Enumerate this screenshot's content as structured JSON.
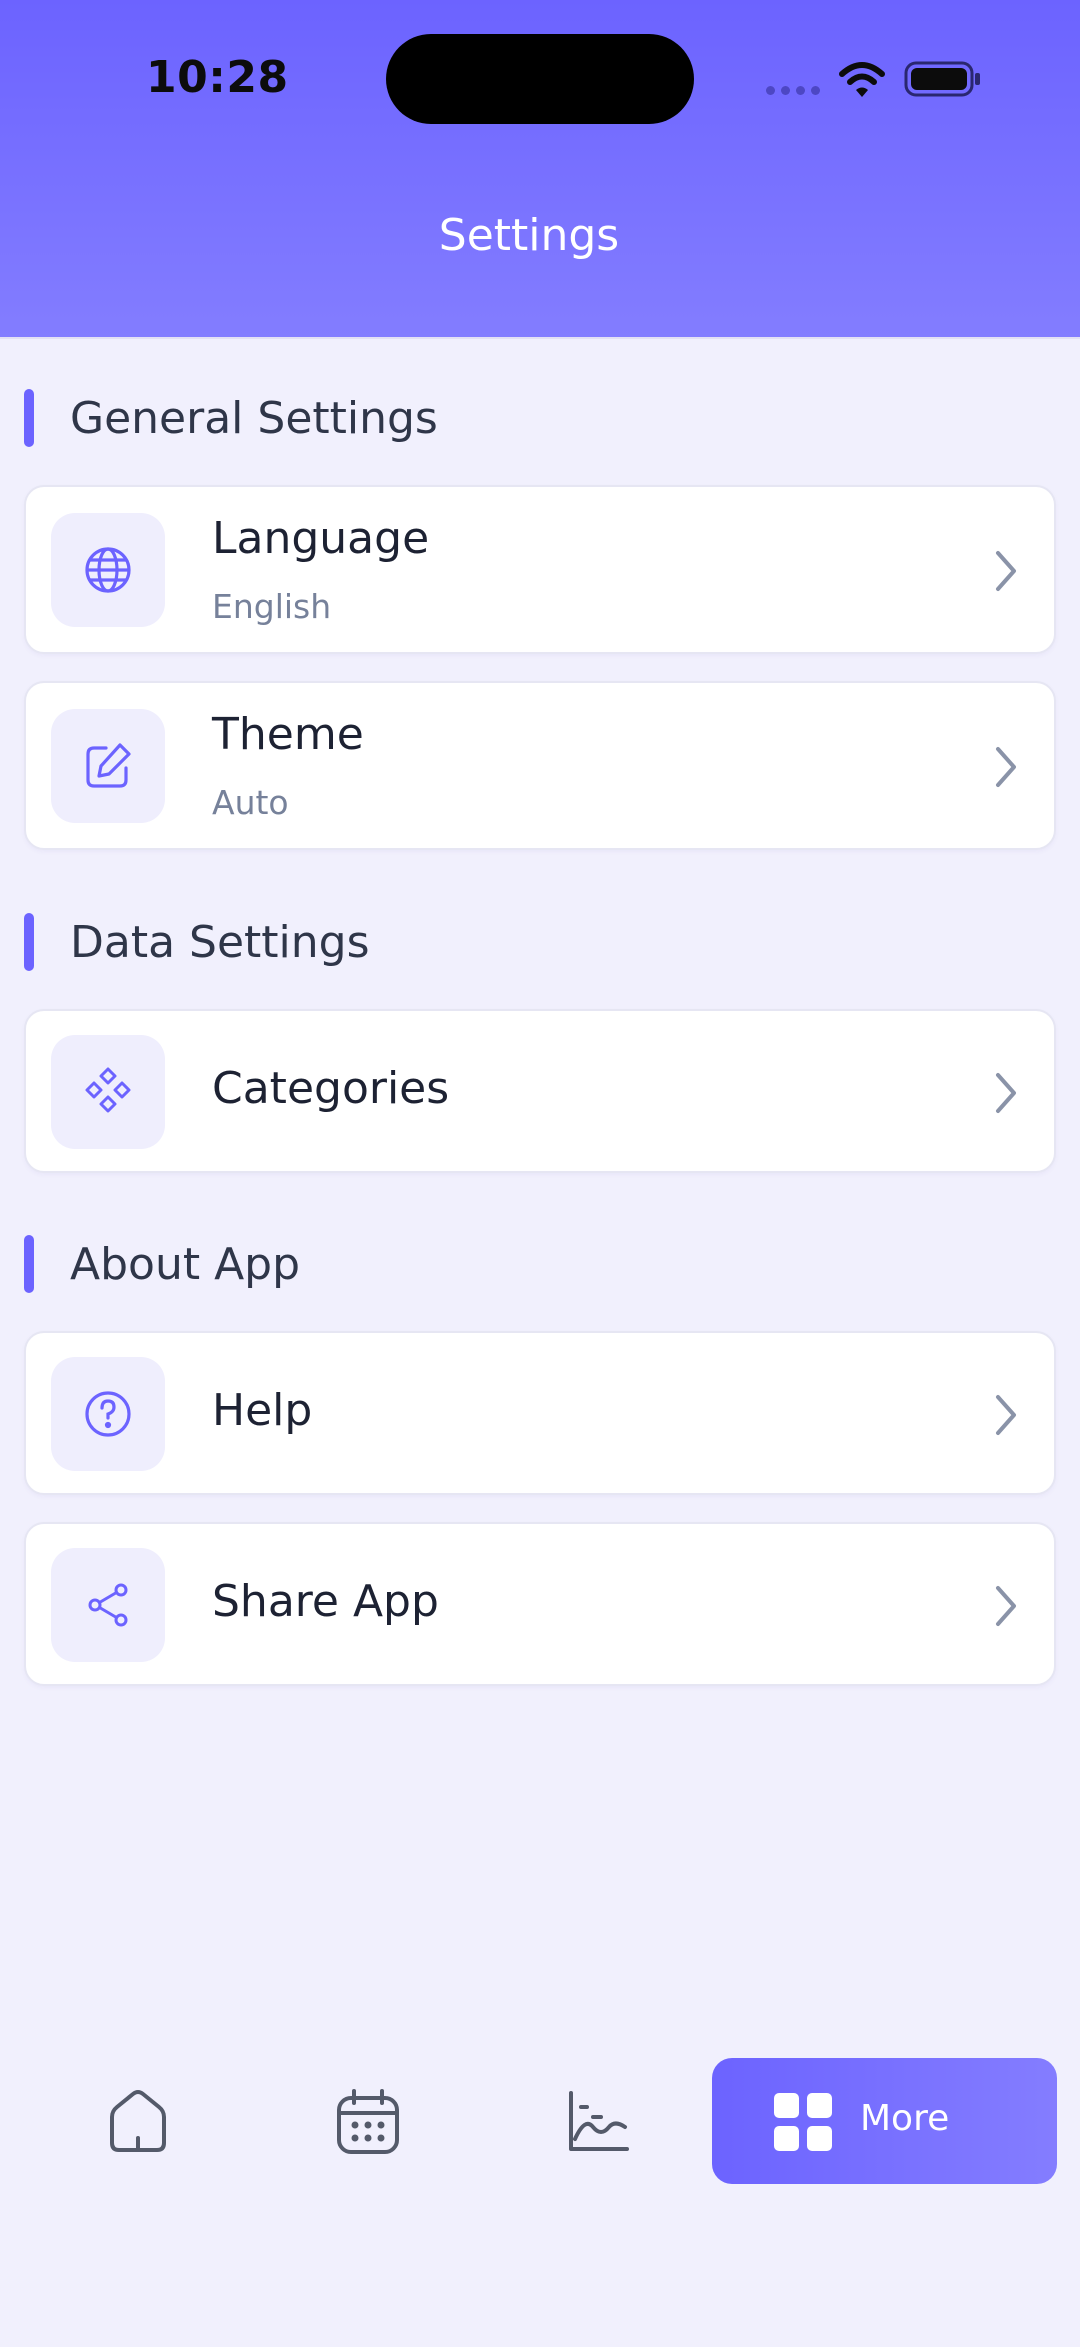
{
  "status_bar": {
    "time": "10:28"
  },
  "header": {
    "title": "Settings"
  },
  "sections": [
    {
      "title": "General Settings",
      "items": [
        {
          "label": "Language",
          "value": "English",
          "icon": "globe-icon"
        },
        {
          "label": "Theme",
          "value": "Auto",
          "icon": "edit-icon"
        }
      ]
    },
    {
      "title": "Data Settings",
      "items": [
        {
          "label": "Categories",
          "icon": "category-icon"
        }
      ]
    },
    {
      "title": "About App",
      "items": [
        {
          "label": "Help",
          "icon": "help-icon"
        },
        {
          "label": "Share App",
          "icon": "share-icon"
        }
      ]
    }
  ],
  "bottom_nav": {
    "items": [
      {
        "icon": "home-icon"
      },
      {
        "icon": "calendar-icon"
      },
      {
        "icon": "chart-icon"
      },
      {
        "icon": "grid-icon",
        "label": "More",
        "active": true
      }
    ]
  },
  "colors": {
    "accent": "#6c63ff",
    "background": "#f1f0fd",
    "card": "#ffffff",
    "text_primary": "#1d2233",
    "text_secondary": "#76819a"
  }
}
